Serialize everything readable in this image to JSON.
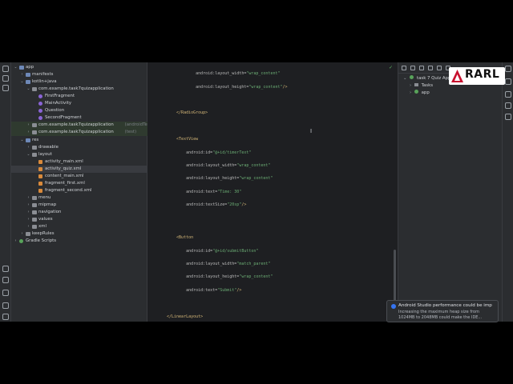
{
  "project_tree": [
    {
      "label": "app",
      "indent": 0,
      "icon": "folder-blue",
      "chevron": "open"
    },
    {
      "label": "manifests",
      "indent": 1,
      "icon": "folder-blue",
      "chevron": "closed"
    },
    {
      "label": "kotlin+java",
      "indent": 1,
      "icon": "folder-blue",
      "chevron": "open"
    },
    {
      "label": "com.example.task7quizapplication",
      "indent": 2,
      "icon": "folder",
      "chevron": "open"
    },
    {
      "label": "FirstFragment",
      "indent": 3,
      "icon": "kotlin",
      "chevron": ""
    },
    {
      "label": "MainActivity",
      "indent": 3,
      "icon": "kotlin",
      "chevron": ""
    },
    {
      "label": "Question",
      "indent": 3,
      "icon": "kotlin",
      "chevron": ""
    },
    {
      "label": "SecondFragment",
      "indent": 3,
      "icon": "kotlin",
      "chevron": ""
    },
    {
      "label": "com.example.task7quizapplication",
      "suffix": "(androidTest)",
      "indent": 2,
      "icon": "folder",
      "chevron": "closed",
      "variant": "test"
    },
    {
      "label": "com.example.task7quizapplication",
      "suffix": "(test)",
      "indent": 2,
      "icon": "folder",
      "chevron": "closed",
      "variant": "test"
    },
    {
      "label": "res",
      "indent": 1,
      "icon": "folder-blue",
      "chevron": "open"
    },
    {
      "label": "drawable",
      "indent": 2,
      "icon": "folder",
      "chevron": "closed"
    },
    {
      "label": "layout",
      "indent": 2,
      "icon": "folder",
      "chevron": "open"
    },
    {
      "label": "activity_main.xml",
      "indent": 3,
      "icon": "xml",
      "chevron": ""
    },
    {
      "label": "activity_quiz.xml",
      "indent": 3,
      "icon": "xml",
      "chevron": "",
      "variant": "selected"
    },
    {
      "label": "content_main.xml",
      "indent": 3,
      "icon": "xml",
      "chevron": ""
    },
    {
      "label": "fragment_first.xml",
      "indent": 3,
      "icon": "xml",
      "chevron": ""
    },
    {
      "label": "fragment_second.xml",
      "indent": 3,
      "icon": "xml",
      "chevron": ""
    },
    {
      "label": "menu",
      "indent": 2,
      "icon": "folder",
      "chevron": "closed"
    },
    {
      "label": "mipmap",
      "indent": 2,
      "icon": "folder",
      "chevron": "closed"
    },
    {
      "label": "navigation",
      "indent": 2,
      "icon": "folder",
      "chevron": "closed"
    },
    {
      "label": "values",
      "indent": 2,
      "icon": "folder",
      "chevron": "closed"
    },
    {
      "label": "xml",
      "indent": 2,
      "icon": "folder",
      "chevron": "closed"
    },
    {
      "label": "keepRules",
      "indent": 1,
      "icon": "folder",
      "chevron": "closed"
    },
    {
      "label": "Gradle Scripts",
      "indent": 0,
      "icon": "gradle",
      "chevron": "closed"
    }
  ],
  "editor": {
    "lines": [
      {
        "n": "",
        "parts": []
      },
      {
        "n": "",
        "parts": [
          [
            "attr",
            "            android:layout_width="
          ],
          [
            "val",
            "\"wrap_content\""
          ]
        ]
      },
      {
        "n": "",
        "parts": []
      },
      {
        "n": "",
        "parts": [
          [
            "attr",
            "            android:layout_height="
          ],
          [
            "val",
            "\"wrap_content\""
          ],
          [
            "tag",
            "/>"
          ]
        ]
      },
      {
        "n": "",
        "parts": []
      },
      {
        "n": "",
        "parts": []
      },
      {
        "n": "",
        "parts": []
      },
      {
        "n": "",
        "parts": [
          [
            "tag",
            "    </RadioGroup>"
          ]
        ]
      },
      {
        "n": "",
        "parts": []
      },
      {
        "n": "",
        "parts": []
      },
      {
        "n": "",
        "parts": []
      },
      {
        "n": "",
        "parts": [
          [
            "tag",
            "    <TextView"
          ]
        ]
      },
      {
        "n": "",
        "parts": []
      },
      {
        "n": "",
        "parts": [
          [
            "attr",
            "        android:id="
          ],
          [
            "val",
            "\"@+id/timerText\""
          ]
        ]
      },
      {
        "n": "",
        "parts": []
      },
      {
        "n": "",
        "parts": [
          [
            "attr",
            "        android:layout_width="
          ],
          [
            "val",
            "\"wrap_content\""
          ]
        ]
      },
      {
        "n": "",
        "parts": []
      },
      {
        "n": "",
        "parts": [
          [
            "attr",
            "        android:layout_height="
          ],
          [
            "val",
            "\"wrap_content\""
          ]
        ]
      },
      {
        "n": "",
        "parts": []
      },
      {
        "n": "",
        "parts": [
          [
            "attr",
            "        android:text="
          ],
          [
            "val",
            "\"Time: 30\""
          ]
        ]
      },
      {
        "n": "",
        "parts": []
      },
      {
        "n": "",
        "parts": [
          [
            "attr",
            "        android:textSize="
          ],
          [
            "val",
            "\"20sp\""
          ],
          [
            "tag",
            "/>"
          ]
        ]
      },
      {
        "n": "",
        "parts": []
      },
      {
        "n": "",
        "parts": []
      },
      {
        "n": "",
        "parts": []
      },
      {
        "n": "",
        "parts": []
      },
      {
        "n": "",
        "parts": [
          [
            "tag",
            "    <Button"
          ]
        ]
      },
      {
        "n": "",
        "parts": []
      },
      {
        "n": "",
        "parts": [
          [
            "attr",
            "        android:id="
          ],
          [
            "val",
            "\"@+id/submitButton\""
          ]
        ]
      },
      {
        "n": "",
        "parts": []
      },
      {
        "n": "",
        "parts": [
          [
            "attr",
            "        android:layout_width="
          ],
          [
            "val",
            "\"match_parent\""
          ]
        ]
      },
      {
        "n": "",
        "parts": []
      },
      {
        "n": "",
        "parts": [
          [
            "attr",
            "        android:layout_height="
          ],
          [
            "val",
            "\"wrap_content\""
          ]
        ]
      },
      {
        "n": "",
        "parts": []
      },
      {
        "n": "",
        "parts": [
          [
            "attr",
            "        android:text="
          ],
          [
            "val",
            "\"Submit\""
          ],
          [
            "tag",
            "/>"
          ]
        ]
      },
      {
        "n": "",
        "parts": []
      },
      {
        "n": "",
        "parts": []
      },
      {
        "n": "",
        "parts": []
      },
      {
        "n": "",
        "parts": [
          [
            "tag",
            "</LinearLayout>"
          ]
        ]
      },
      {
        "n": "",
        "parts": []
      }
    ]
  },
  "gradle_panel": {
    "root": "task 7 Quiz Applic",
    "items": [
      "Tasks",
      "app"
    ]
  },
  "logo": {
    "text": "RARL"
  },
  "notification": {
    "title": "Android Studio performance could be imp",
    "body": "Increasing the maximum heap size from 1024MB to 2048MB could make the IDE..."
  },
  "colors": {
    "background": "#1e1f22",
    "panel": "#2b2d30",
    "tag": "#d5b778",
    "value": "#6aab73",
    "accent": "#3574f0",
    "logo_red": "#c8102e"
  }
}
